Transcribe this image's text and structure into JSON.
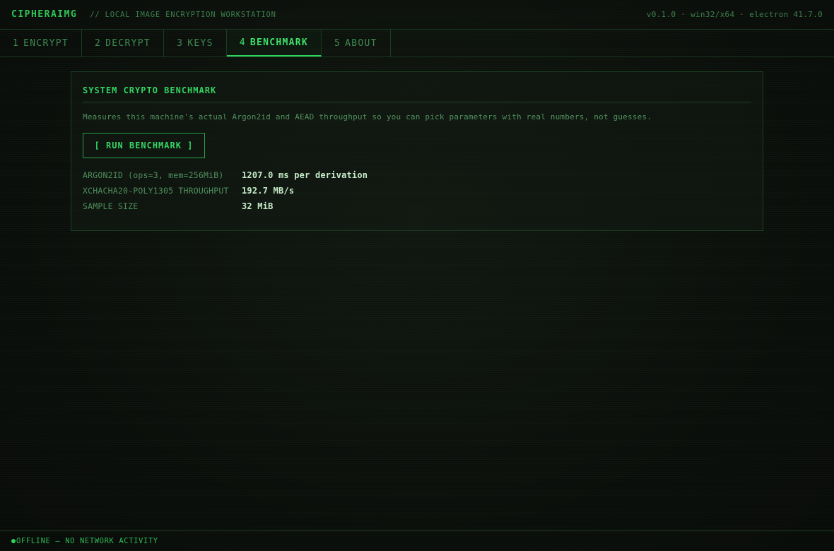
{
  "header": {
    "logo": "CIPHERAIMG",
    "subtitle": "// LOCAL IMAGE ENCRYPTION WORKSTATION",
    "version": "v0.1.0 · win32/x64 · electron 41.7.0"
  },
  "tabs": [
    {
      "num": "1",
      "label": "ENCRYPT",
      "active": false
    },
    {
      "num": "2",
      "label": "DECRYPT",
      "active": false
    },
    {
      "num": "3",
      "label": "KEYS",
      "active": false
    },
    {
      "num": "4",
      "label": "BENCHMARK",
      "active": true
    },
    {
      "num": "5",
      "label": "ABOUT",
      "active": false
    }
  ],
  "panel": {
    "title": "SYSTEM CRYPTO BENCHMARK",
    "description": "Measures this machine's actual Argon2id and AEAD throughput so you can pick parameters with real numbers, not guesses.",
    "run_button": "[ RUN BENCHMARK ]",
    "results": [
      {
        "label": "ARGON2ID (ops=3, mem=256MiB)",
        "value": "1207.0 ms per derivation"
      },
      {
        "label": "XCHACHA20-POLY1305 THROUGHPUT",
        "value": "192.7 MB/s"
      },
      {
        "label": "SAMPLE SIZE",
        "value": "32 MiB"
      }
    ]
  },
  "statusbar": {
    "text": "OFFLINE — NO NETWORK ACTIVITY"
  },
  "colors": {
    "accent": "#2fd35e",
    "background": "#0b100c",
    "border": "#1b3a22"
  }
}
